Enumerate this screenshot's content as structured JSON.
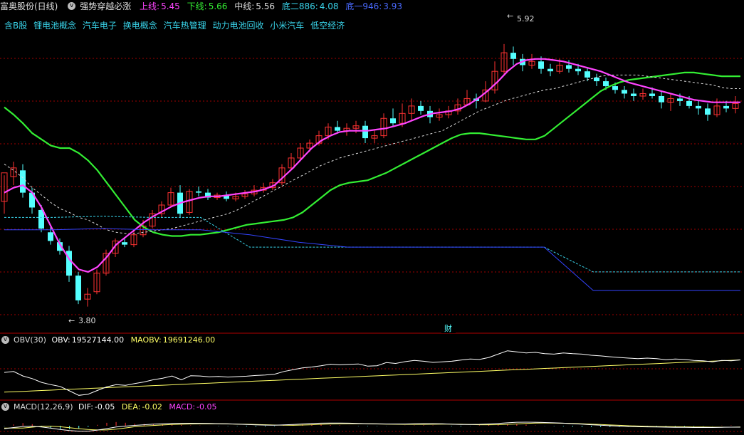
{
  "header": {
    "stock": "富奥股份(日线)",
    "indicator": "强势穿越必涨",
    "values": [
      {
        "label": "上线:",
        "value": "5.45",
        "color": "#ff44ff"
      },
      {
        "label": "下线:",
        "value": "5.66",
        "color": "#33ee33"
      },
      {
        "label": "中线:",
        "value": "5.56",
        "color": "#dddddd"
      },
      {
        "label": "底二886:",
        "value": "4.08",
        "color": "#39d4ea"
      },
      {
        "label": "底一946:",
        "value": "3.93",
        "color": "#4a6aff"
      }
    ]
  },
  "concepts": [
    "含B股",
    "锂电池概念",
    "汽车电子",
    "换电概念",
    "汽车热管理",
    "动力电池回收",
    "小米汽车",
    "低空经济"
  ],
  "annotations": {
    "high": "5.92",
    "low": "3.80",
    "marker": "财"
  },
  "obv_panel": {
    "title": "OBV(30)",
    "obv_label": "OBV:",
    "obv_value": "19527144.00",
    "maobv_label": "MAOBV:",
    "maobv_value": "19691246.00"
  },
  "macd_panel": {
    "title": "MACD(12,26,9)",
    "dif_label": "DIF:",
    "dif_value": "-0.05",
    "dea_label": "DEA:",
    "dea_value": "-0.02",
    "macd_label": "MACD:",
    "macd_value": "-0.05"
  },
  "colors": {
    "up": "#ff3232",
    "down": "#54ffff",
    "upper": "#ff44ff",
    "lower": "#33ee33",
    "middle": "#dddddd",
    "bottom2": "#39d4ea",
    "bottom1": "#3344ff",
    "maobv": "#ffff66",
    "grid": "#a00000"
  },
  "chart_data": {
    "type": "candlestick",
    "ylim": [
      3.7,
      6.0
    ],
    "candles": [
      [
        4.65,
        4.88,
        4.86,
        4.55
      ],
      [
        4.85,
        4.92,
        4.97,
        4.78
      ],
      [
        4.9,
        4.72,
        4.95,
        4.68
      ],
      [
        4.72,
        4.6,
        4.76,
        4.55
      ],
      [
        4.58,
        4.43,
        4.62,
        4.4
      ],
      [
        4.4,
        4.33,
        4.44,
        4.3
      ],
      [
        4.32,
        4.25,
        4.35,
        4.22
      ],
      [
        4.25,
        4.05,
        4.29,
        4.0
      ],
      [
        4.05,
        3.85,
        4.08,
        3.82
      ],
      [
        3.86,
        3.9,
        3.95,
        3.8
      ],
      [
        3.92,
        4.07,
        4.1,
        3.9
      ],
      [
        4.07,
        4.23,
        4.26,
        4.05
      ],
      [
        4.23,
        4.33,
        4.35,
        4.2
      ],
      [
        4.32,
        4.3,
        4.36,
        4.28
      ],
      [
        4.3,
        4.38,
        4.42,
        4.28
      ],
      [
        4.38,
        4.45,
        4.5,
        4.36
      ],
      [
        4.45,
        4.55,
        4.58,
        4.43
      ],
      [
        4.55,
        4.62,
        4.65,
        4.52
      ],
      [
        4.62,
        4.72,
        4.76,
        4.6
      ],
      [
        4.72,
        4.55,
        4.78,
        4.52
      ],
      [
        4.56,
        4.73,
        4.75,
        4.54
      ],
      [
        4.73,
        4.72,
        4.77,
        4.69
      ],
      [
        4.72,
        4.68,
        4.75,
        4.66
      ],
      [
        4.68,
        4.7,
        4.72,
        4.66
      ],
      [
        4.7,
        4.67,
        4.73,
        4.65
      ],
      [
        4.67,
        4.69,
        4.72,
        4.65
      ],
      [
        4.69,
        4.71,
        4.74,
        4.67
      ],
      [
        4.71,
        4.74,
        4.78,
        4.69
      ],
      [
        4.74,
        4.76,
        4.8,
        4.72
      ],
      [
        4.76,
        4.8,
        4.83,
        4.74
      ],
      [
        4.8,
        4.92,
        4.95,
        4.78
      ],
      [
        4.92,
        5.0,
        5.04,
        4.9
      ],
      [
        5.0,
        5.08,
        5.12,
        4.98
      ],
      [
        5.08,
        5.12,
        5.15,
        5.05
      ],
      [
        5.12,
        5.18,
        5.22,
        5.1
      ],
      [
        5.18,
        5.25,
        5.28,
        5.15
      ],
      [
        5.25,
        5.22,
        5.3,
        5.2
      ],
      [
        5.22,
        5.24,
        5.28,
        5.18
      ],
      [
        5.24,
        5.26,
        5.3,
        5.2
      ],
      [
        5.26,
        5.16,
        5.3,
        5.12
      ],
      [
        5.16,
        5.18,
        5.22,
        5.12
      ],
      [
        5.18,
        5.32,
        5.36,
        5.16
      ],
      [
        5.32,
        5.28,
        5.4,
        5.25
      ],
      [
        5.28,
        5.36,
        5.44,
        5.25
      ],
      [
        5.36,
        5.42,
        5.48,
        5.3
      ],
      [
        5.42,
        5.38,
        5.46,
        5.35
      ],
      [
        5.38,
        5.33,
        5.42,
        5.28
      ],
      [
        5.33,
        5.35,
        5.4,
        5.3
      ],
      [
        5.35,
        5.38,
        5.42,
        5.32
      ],
      [
        5.38,
        5.43,
        5.48,
        5.35
      ],
      [
        5.43,
        5.48,
        5.55,
        5.42
      ],
      [
        5.48,
        5.46,
        5.52,
        5.4
      ],
      [
        5.46,
        5.55,
        5.62,
        5.45
      ],
      [
        5.55,
        5.7,
        5.78,
        5.52
      ],
      [
        5.7,
        5.85,
        5.92,
        5.68
      ],
      [
        5.85,
        5.8,
        5.9,
        5.75
      ],
      [
        5.8,
        5.75,
        5.84,
        5.7
      ],
      [
        5.75,
        5.78,
        5.84,
        5.72
      ],
      [
        5.78,
        5.72,
        5.82,
        5.68
      ],
      [
        5.72,
        5.7,
        5.76,
        5.66
      ],
      [
        5.7,
        5.75,
        5.8,
        5.68
      ],
      [
        5.75,
        5.72,
        5.79,
        5.69
      ],
      [
        5.72,
        5.7,
        5.76,
        5.67
      ],
      [
        5.7,
        5.65,
        5.73,
        5.62
      ],
      [
        5.65,
        5.62,
        5.68,
        5.58
      ],
      [
        5.62,
        5.58,
        5.65,
        5.55
      ],
      [
        5.58,
        5.55,
        5.61,
        5.52
      ],
      [
        5.55,
        5.52,
        5.58,
        5.48
      ],
      [
        5.52,
        5.5,
        5.56,
        5.46
      ],
      [
        5.5,
        5.52,
        5.56,
        5.47
      ],
      [
        5.52,
        5.5,
        5.57,
        5.48
      ],
      [
        5.5,
        5.45,
        5.54,
        5.4
      ],
      [
        5.45,
        5.48,
        5.52,
        5.38
      ],
      [
        5.48,
        5.46,
        5.52,
        5.42
      ],
      [
        5.46,
        5.42,
        5.5,
        5.4
      ],
      [
        5.42,
        5.4,
        5.46,
        5.35
      ],
      [
        5.4,
        5.35,
        5.44,
        5.3
      ],
      [
        5.35,
        5.42,
        5.48,
        5.33
      ],
      [
        5.42,
        5.4,
        5.46,
        5.37
      ],
      [
        5.4,
        5.44,
        5.5,
        5.36
      ]
    ],
    "upper": [
      4.72,
      4.76,
      4.78,
      4.72,
      4.6,
      4.45,
      4.3,
      4.18,
      4.1,
      4.08,
      4.12,
      4.2,
      4.3,
      4.36,
      4.42,
      4.48,
      4.53,
      4.57,
      4.61,
      4.64,
      4.66,
      4.68,
      4.69,
      4.69,
      4.7,
      4.71,
      4.72,
      4.73,
      4.75,
      4.78,
      4.85,
      4.92,
      5.0,
      5.08,
      5.14,
      5.18,
      5.21,
      5.22,
      5.22,
      5.22,
      5.23,
      5.24,
      5.26,
      5.28,
      5.31,
      5.34,
      5.36,
      5.37,
      5.38,
      5.4,
      5.44,
      5.49,
      5.55,
      5.62,
      5.7,
      5.76,
      5.79,
      5.8,
      5.8,
      5.79,
      5.78,
      5.76,
      5.74,
      5.72,
      5.7,
      5.67,
      5.64,
      5.61,
      5.59,
      5.57,
      5.55,
      5.53,
      5.51,
      5.49,
      5.47,
      5.46,
      5.45,
      5.45,
      5.45,
      5.45
    ],
    "lower": [
      5.41,
      5.35,
      5.28,
      5.2,
      5.15,
      5.1,
      5.08,
      5.08,
      5.04,
      4.98,
      4.9,
      4.8,
      4.7,
      4.6,
      4.5,
      4.44,
      4.4,
      4.38,
      4.37,
      4.37,
      4.38,
      4.38,
      4.39,
      4.4,
      4.42,
      4.44,
      4.46,
      4.47,
      4.48,
      4.49,
      4.5,
      4.52,
      4.56,
      4.62,
      4.68,
      4.74,
      4.78,
      4.8,
      4.81,
      4.82,
      4.85,
      4.88,
      4.92,
      4.96,
      5.0,
      5.04,
      5.08,
      5.12,
      5.16,
      5.19,
      5.2,
      5.2,
      5.19,
      5.18,
      5.17,
      5.16,
      5.15,
      5.15,
      5.18,
      5.24,
      5.3,
      5.36,
      5.42,
      5.48,
      5.54,
      5.58,
      5.61,
      5.63,
      5.64,
      5.65,
      5.66,
      5.67,
      5.68,
      5.69,
      5.69,
      5.68,
      5.67,
      5.66,
      5.66,
      5.66
    ],
    "middle": [
      4.95,
      4.9,
      4.84,
      4.76,
      4.7,
      4.64,
      4.59,
      4.56,
      4.52,
      4.5,
      4.46,
      4.42,
      4.4,
      4.39,
      4.39,
      4.4,
      4.41,
      4.42,
      4.43,
      4.45,
      4.47,
      4.49,
      4.51,
      4.53,
      4.55,
      4.58,
      4.62,
      4.66,
      4.7,
      4.74,
      4.78,
      4.82,
      4.86,
      4.9,
      4.94,
      4.97,
      5.0,
      5.02,
      5.04,
      5.06,
      5.08,
      5.1,
      5.12,
      5.14,
      5.16,
      5.18,
      5.2,
      5.22,
      5.26,
      5.3,
      5.34,
      5.38,
      5.41,
      5.44,
      5.47,
      5.49,
      5.51,
      5.53,
      5.55,
      5.56,
      5.58,
      5.6,
      5.62,
      5.64,
      5.66,
      5.67,
      5.67,
      5.67,
      5.67,
      5.66,
      5.65,
      5.64,
      5.63,
      5.62,
      5.61,
      5.6,
      5.59,
      5.57,
      5.56,
      5.56
    ],
    "bottom2": [
      4.52,
      4.52,
      4.53,
      4.52,
      4.52,
      4.28,
      4.28,
      4.28,
      4.28,
      4.28,
      4.28,
      4.28,
      4.08,
      4.08,
      4.08,
      4.08
    ],
    "bottom1": [
      4.42,
      4.42,
      4.43,
      4.42,
      4.42,
      4.38,
      4.32,
      4.28,
      4.28,
      4.28,
      4.28,
      4.28,
      3.93,
      3.93,
      3.93,
      3.93
    ]
  }
}
